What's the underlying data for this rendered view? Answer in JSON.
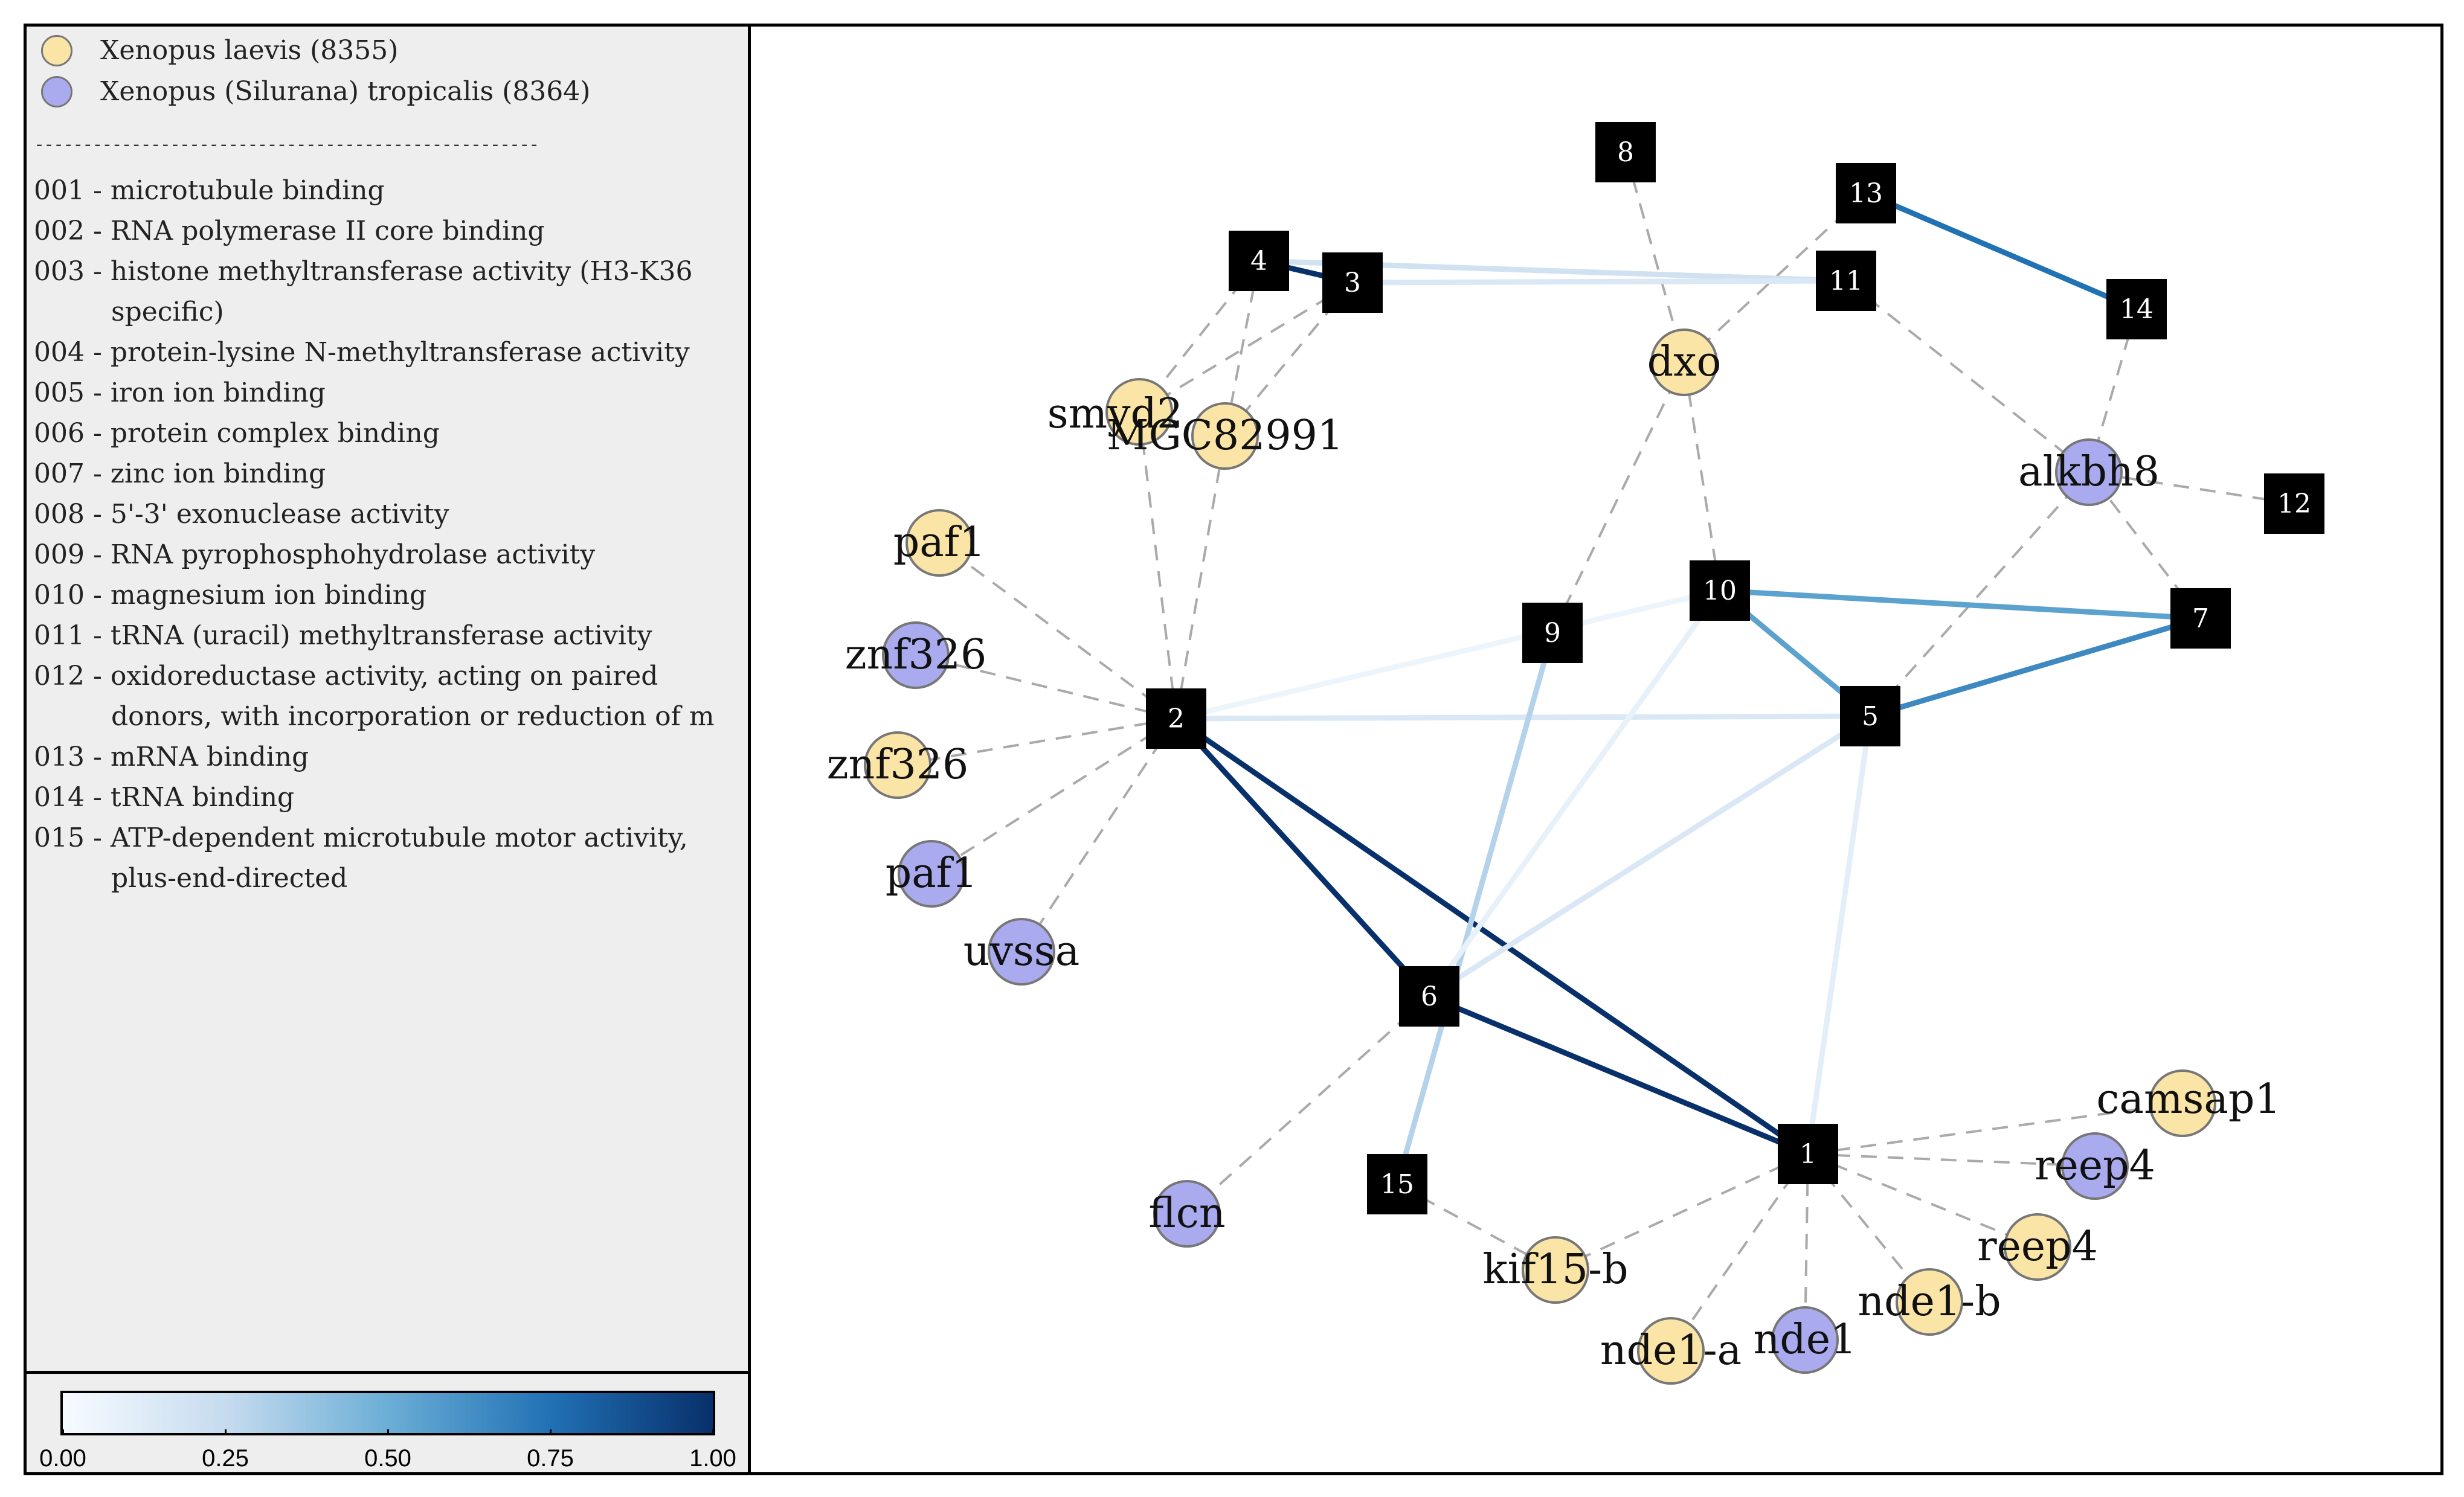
{
  "legend": {
    "species": [
      {
        "label": "Xenopus laevis (8355)",
        "color": "#fbe5a6"
      },
      {
        "label": "Xenopus (Silurana) tropicalis (8364)",
        "color": "#aaaaee"
      }
    ],
    "divider": "----------------------------------------------------",
    "go_terms": [
      {
        "lines": [
          "001 - microtubule binding"
        ]
      },
      {
        "lines": [
          "002 - RNA polymerase II core binding"
        ]
      },
      {
        "lines": [
          "003 - histone methyltransferase activity (H3-K36",
          "specific)"
        ]
      },
      {
        "lines": [
          "004 - protein-lysine N-methyltransferase activity"
        ]
      },
      {
        "lines": [
          "005 - iron ion binding"
        ]
      },
      {
        "lines": [
          "006 - protein complex binding"
        ]
      },
      {
        "lines": [
          "007 - zinc ion binding"
        ]
      },
      {
        "lines": [
          "008 - 5'-3' exonuclease activity"
        ]
      },
      {
        "lines": [
          "009 - RNA pyrophosphohydrolase activity"
        ]
      },
      {
        "lines": [
          "010 - magnesium ion binding"
        ]
      },
      {
        "lines": [
          "011 - tRNA (uracil) methyltransferase activity"
        ]
      },
      {
        "lines": [
          "012 - oxidoreductase activity, acting on paired",
          "donors, with incorporation or reduction of m"
        ]
      },
      {
        "lines": [
          "013 - mRNA binding"
        ]
      },
      {
        "lines": [
          "014 - tRNA binding"
        ]
      },
      {
        "lines": [
          "015 - ATP-dependent microtubule motor activity,",
          "plus-end-directed"
        ]
      }
    ]
  },
  "colorbar": {
    "ticks": [
      "0.00",
      "0.25",
      "0.50",
      "0.75",
      "1.00"
    ],
    "colors": [
      "#f7fbff",
      "#c6dbef",
      "#6baed6",
      "#2171b5",
      "#08306b"
    ]
  },
  "graph": {
    "go_nodes": [
      {
        "id": "1"
      },
      {
        "id": "2"
      },
      {
        "id": "3"
      },
      {
        "id": "4"
      },
      {
        "id": "5"
      },
      {
        "id": "6"
      },
      {
        "id": "7"
      },
      {
        "id": "8"
      },
      {
        "id": "9"
      },
      {
        "id": "10"
      },
      {
        "id": "11"
      },
      {
        "id": "12"
      },
      {
        "id": "13"
      },
      {
        "id": "14"
      },
      {
        "id": "15"
      }
    ],
    "gene_nodes": [
      {
        "label": "smyd2",
        "species": 0
      },
      {
        "label": "MGC82991",
        "species": 0
      },
      {
        "label": "dxo",
        "species": 0
      },
      {
        "label": "alkbh8",
        "species": 1
      },
      {
        "label": "paf1",
        "species": 0
      },
      {
        "label": "znf326",
        "species": 1
      },
      {
        "label": "znf326",
        "species": 0
      },
      {
        "label": "paf1",
        "species": 1
      },
      {
        "label": "uvssa",
        "species": 1
      },
      {
        "label": "flcn",
        "species": 1
      },
      {
        "label": "kif15-b",
        "species": 0
      },
      {
        "label": "nde1-a",
        "species": 0
      },
      {
        "label": "nde1",
        "species": 1
      },
      {
        "label": "nde1-b",
        "species": 0
      },
      {
        "label": "reep4",
        "species": 0
      },
      {
        "label": "reep4",
        "species": 1
      },
      {
        "label": "camsap1",
        "species": 0
      }
    ],
    "weighted_edges": [
      {
        "a": "4",
        "b": "3",
        "weight": 1.0
      },
      {
        "a": "4",
        "b": "11",
        "weight": 0.2
      },
      {
        "a": "3",
        "b": "11",
        "weight": 0.15
      },
      {
        "a": "13",
        "b": "14",
        "weight": 0.75
      },
      {
        "a": "10",
        "b": "7",
        "weight": 0.55
      },
      {
        "a": "10",
        "b": "5",
        "weight": 0.55
      },
      {
        "a": "5",
        "b": "7",
        "weight": 0.65
      },
      {
        "a": "2",
        "b": "10",
        "weight": 0.05
      },
      {
        "a": "2",
        "b": "5",
        "weight": 0.15
      },
      {
        "a": "2",
        "b": "6",
        "weight": 1.0
      },
      {
        "a": "2",
        "b": "1",
        "weight": 1.0
      },
      {
        "a": "6",
        "b": "1",
        "weight": 1.0
      },
      {
        "a": "9",
        "b": "15",
        "weight": 0.3
      },
      {
        "a": "10",
        "b": "6",
        "weight": 0.08
      },
      {
        "a": "5",
        "b": "6",
        "weight": 0.15
      },
      {
        "a": "5",
        "b": "1",
        "weight": 0.1
      }
    ],
    "dashed_edges": [
      [
        "4",
        "smyd2"
      ],
      [
        "4",
        "MGC82991"
      ],
      [
        "3",
        "smyd2"
      ],
      [
        "3",
        "MGC82991"
      ],
      [
        "2",
        "smyd2"
      ],
      [
        "2",
        "MGC82991"
      ],
      [
        "2",
        "paf1-a"
      ],
      [
        "2",
        "znf326-b"
      ],
      [
        "2",
        "znf326-a"
      ],
      [
        "2",
        "paf1-b"
      ],
      [
        "2",
        "uvssa"
      ],
      [
        "8",
        "dxo"
      ],
      [
        "13",
        "dxo"
      ],
      [
        "9",
        "dxo"
      ],
      [
        "10",
        "dxo"
      ],
      [
        "11",
        "alkbh8"
      ],
      [
        "14",
        "alkbh8"
      ],
      [
        "12",
        "alkbh8"
      ],
      [
        "7",
        "alkbh8"
      ],
      [
        "5",
        "alkbh8"
      ],
      [
        "6",
        "flcn"
      ],
      [
        "15",
        "kif15-b"
      ],
      [
        "1",
        "kif15-b"
      ],
      [
        "1",
        "nde1-a"
      ],
      [
        "1",
        "nde1"
      ],
      [
        "1",
        "nde1-b"
      ],
      [
        "1",
        "reep4-a"
      ],
      [
        "1",
        "reep4-b"
      ],
      [
        "1",
        "camsap1"
      ]
    ]
  }
}
